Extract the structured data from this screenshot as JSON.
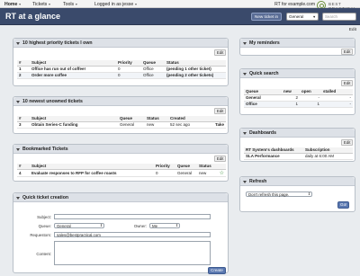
{
  "topbar": {
    "home": "Home",
    "tickets": "Tickets",
    "tools": "Tools",
    "logged_in": "Logged in as jesse",
    "rt_for": "RT for example.com",
    "logo_line1": "BEST",
    "logo_line2": "PRACTICAL"
  },
  "header": {
    "title": "RT at a glance",
    "new_ticket": "New ticket in",
    "queue_selected": "General",
    "search_placeholder": "Search"
  },
  "page_edit": "Edit",
  "colors": {
    "header_bg": "#3a4a6b",
    "panel_header": "#dde1e7",
    "star": "#2e8b2e",
    "button": "#5a78b0"
  },
  "priority": {
    "title": "10 highest priority tickets I own",
    "edit": "Edit",
    "columns": [
      "#",
      "Subject",
      "Priority",
      "Queue",
      "Status"
    ],
    "rows": [
      {
        "id": "1",
        "subject": "Office has run out of coffee!",
        "priority": "0",
        "queue": "Office",
        "status": "(pending 1 other ticket)"
      },
      {
        "id": "2",
        "subject": "Order more coffee",
        "priority": "0",
        "queue": "Office",
        "status": "(pending 2 other tickets)"
      }
    ]
  },
  "unowned": {
    "title": "10 newest unowned tickets",
    "edit": "Edit",
    "columns": [
      "#",
      "Subject",
      "Queue",
      "Status",
      "Created"
    ],
    "rows": [
      {
        "id": "3",
        "subject": "Obtain Series-C funding",
        "queue": "General",
        "status": "new",
        "created": "52 sec ago",
        "action": "Take"
      }
    ]
  },
  "bookmarked": {
    "title": "Bookmarked Tickets",
    "edit": "Edit",
    "columns": [
      "#",
      "Subject",
      "Priority",
      "Queue",
      "Status"
    ],
    "rows": [
      {
        "id": "4",
        "subject": "Evaluate responses to RFP for coffee roasts",
        "priority": "0",
        "queue": "General",
        "status": "new",
        "icon": "star-icon"
      }
    ]
  },
  "quick_create": {
    "title": "Quick ticket creation",
    "subject_label": "Subject:",
    "queue_label": "Queue:",
    "queue_value": "General",
    "owner_label": "Owner:",
    "owner_value": "Me",
    "requestors_label": "Requestors:",
    "requestors_value": "sales@bestpractical.com",
    "content_label": "Content:",
    "create_button": "Create"
  },
  "reminders": {
    "title": "My reminders",
    "edit": "Edit"
  },
  "quick_search": {
    "title": "Quick search",
    "edit": "Edit",
    "columns": [
      "Queue",
      "new",
      "open",
      "stalled"
    ],
    "rows": [
      {
        "queue": "General",
        "new": "2",
        "open": "-",
        "stalled": "-"
      },
      {
        "queue": "Office",
        "new": "1",
        "open": "1",
        "stalled": "-"
      }
    ]
  },
  "dashboards": {
    "title": "Dashboards",
    "edit": "Edit",
    "columns": [
      "RT System's dashboards",
      "Subscription"
    ],
    "rows": [
      {
        "name": "SLA Performance",
        "subscription": "daily at 6:00 AM"
      }
    ]
  },
  "refresh": {
    "title": "Refresh",
    "select_value": "Don't refresh this page.",
    "go_button": "Go!"
  }
}
